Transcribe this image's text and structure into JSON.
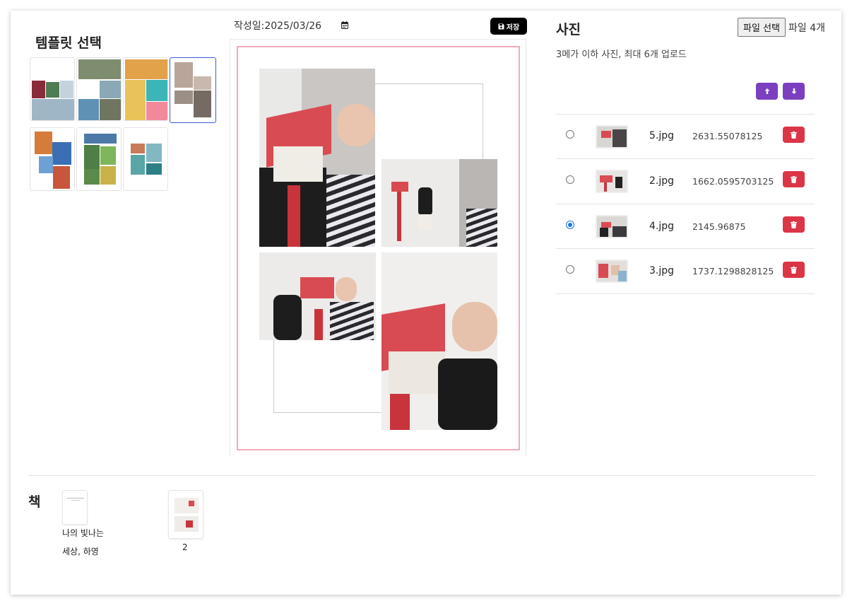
{
  "template_panel": {
    "title": "템플릿 선택",
    "templates": [
      {
        "name": "template-1",
        "selected": false
      },
      {
        "name": "template-2",
        "selected": false
      },
      {
        "name": "template-3",
        "selected": false
      },
      {
        "name": "template-4",
        "selected": true
      },
      {
        "name": "template-5",
        "selected": false
      },
      {
        "name": "template-6",
        "selected": false
      },
      {
        "name": "template-7",
        "selected": false
      }
    ]
  },
  "editor": {
    "date_label": "작성일:",
    "date_value": "2025/03/26",
    "save_label": "저장"
  },
  "photos_panel": {
    "title": "사진",
    "file_button_label": "파일 선택",
    "file_count": "파일 4개",
    "description": "3메가 이하 사진, 최대 6개 업로드",
    "rows": [
      {
        "file": "5.jpg",
        "size": "2631.55078125",
        "selected": false
      },
      {
        "file": "2.jpg",
        "size": "1662.0595703125",
        "selected": false
      },
      {
        "file": "4.jpg",
        "size": "2145.96875",
        "selected": true
      },
      {
        "file": "3.jpg",
        "size": "1737.1298828125",
        "selected": false
      }
    ]
  },
  "book": {
    "title": "책",
    "pages": [
      {
        "label_line1": "나의 빛나는",
        "label_line2": "세상, 하영"
      },
      {
        "label": "2"
      }
    ]
  },
  "colors": {
    "accent_purple": "#7b3fbf",
    "danger_red": "#dc3545",
    "canvas_border_pink": "#f4a9b8",
    "selected_blue": "#3b5bdb"
  }
}
